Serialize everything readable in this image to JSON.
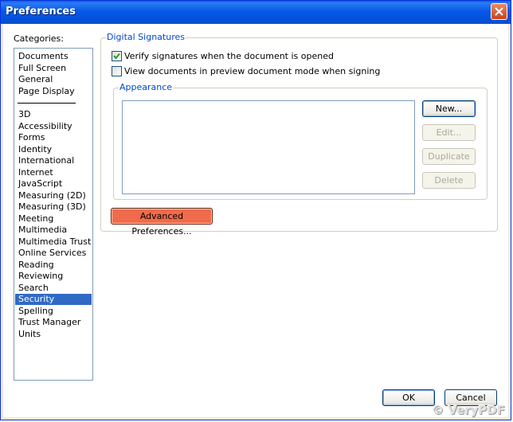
{
  "window": {
    "title": "Preferences"
  },
  "categories": {
    "label": "Categories:",
    "group1": [
      "Documents",
      "Full Screen",
      "General",
      "Page Display"
    ],
    "group2": [
      "3D",
      "Accessibility",
      "Forms",
      "Identity",
      "International",
      "Internet",
      "JavaScript",
      "Measuring (2D)",
      "Measuring (3D)",
      "Meeting",
      "Multimedia",
      "Multimedia Trust",
      "Online Services",
      "Reading",
      "Reviewing",
      "Search",
      "Security",
      "Spelling",
      "Trust Manager",
      "Units"
    ],
    "selected": "Security"
  },
  "digital_signatures": {
    "legend": "Digital Signatures",
    "verify_label": "Verify signatures when the document is opened",
    "verify_checked": true,
    "view_label": "View documents in preview document mode when signing",
    "view_checked": false,
    "appearance": {
      "legend": "Appearance",
      "items": [],
      "new_label": "New...",
      "edit_label": "Edit...",
      "duplicate_label": "Duplicate",
      "delete_label": "Delete"
    },
    "advanced_label": "Advanced Preferences..."
  },
  "footer": {
    "ok_label": "OK",
    "cancel_label": "Cancel"
  },
  "watermark": "© VeryPDF",
  "colors": {
    "selection": "#316ac5",
    "legend_text": "#0046d5",
    "highlight": "#f06b4b",
    "titlebar": "#0458e0"
  }
}
